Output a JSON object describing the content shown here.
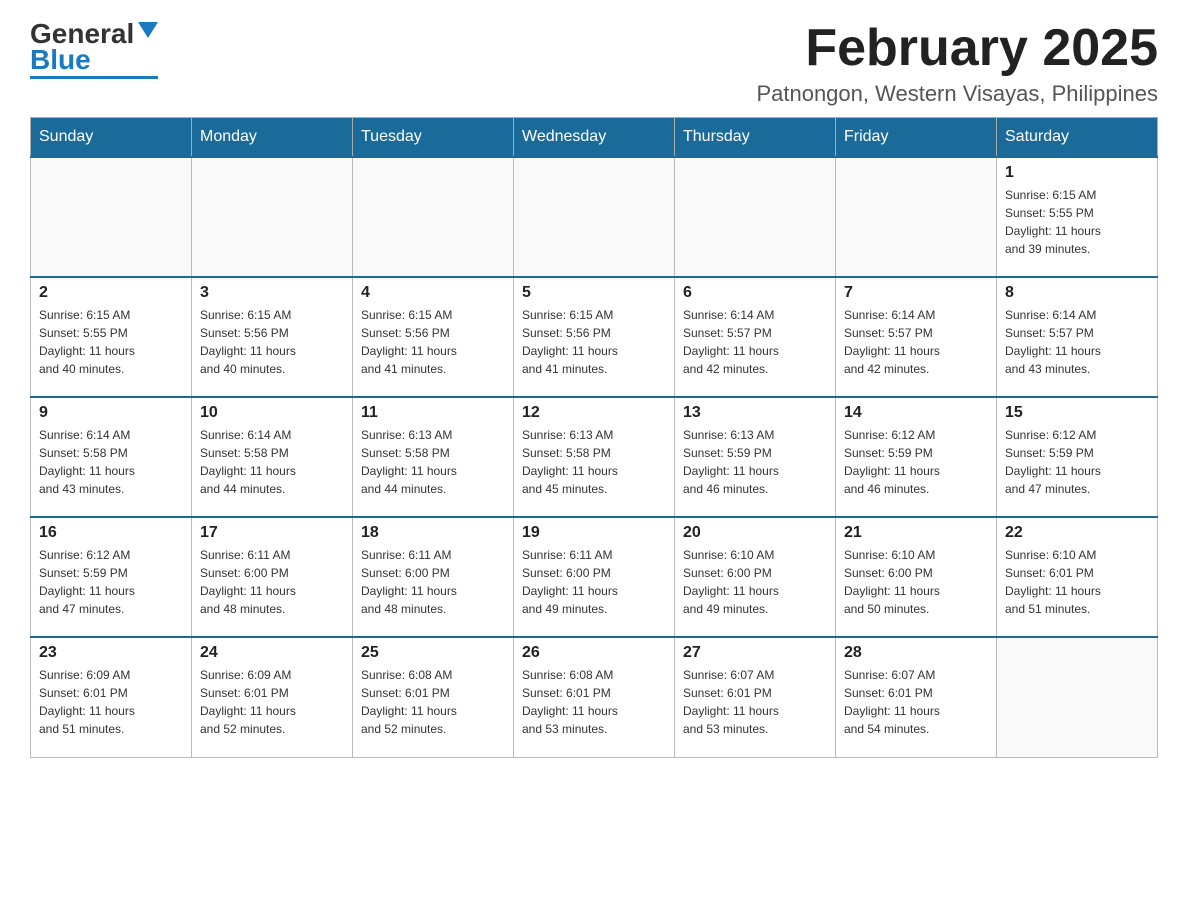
{
  "header": {
    "logo": {
      "general": "General",
      "blue": "Blue"
    },
    "title": "February 2025",
    "location": "Patnongon, Western Visayas, Philippines"
  },
  "calendar": {
    "days_of_week": [
      "Sunday",
      "Monday",
      "Tuesday",
      "Wednesday",
      "Thursday",
      "Friday",
      "Saturday"
    ],
    "weeks": [
      [
        {
          "day": "",
          "info": ""
        },
        {
          "day": "",
          "info": ""
        },
        {
          "day": "",
          "info": ""
        },
        {
          "day": "",
          "info": ""
        },
        {
          "day": "",
          "info": ""
        },
        {
          "day": "",
          "info": ""
        },
        {
          "day": "1",
          "info": "Sunrise: 6:15 AM\nSunset: 5:55 PM\nDaylight: 11 hours\nand 39 minutes."
        }
      ],
      [
        {
          "day": "2",
          "info": "Sunrise: 6:15 AM\nSunset: 5:55 PM\nDaylight: 11 hours\nand 40 minutes."
        },
        {
          "day": "3",
          "info": "Sunrise: 6:15 AM\nSunset: 5:56 PM\nDaylight: 11 hours\nand 40 minutes."
        },
        {
          "day": "4",
          "info": "Sunrise: 6:15 AM\nSunset: 5:56 PM\nDaylight: 11 hours\nand 41 minutes."
        },
        {
          "day": "5",
          "info": "Sunrise: 6:15 AM\nSunset: 5:56 PM\nDaylight: 11 hours\nand 41 minutes."
        },
        {
          "day": "6",
          "info": "Sunrise: 6:14 AM\nSunset: 5:57 PM\nDaylight: 11 hours\nand 42 minutes."
        },
        {
          "day": "7",
          "info": "Sunrise: 6:14 AM\nSunset: 5:57 PM\nDaylight: 11 hours\nand 42 minutes."
        },
        {
          "day": "8",
          "info": "Sunrise: 6:14 AM\nSunset: 5:57 PM\nDaylight: 11 hours\nand 43 minutes."
        }
      ],
      [
        {
          "day": "9",
          "info": "Sunrise: 6:14 AM\nSunset: 5:58 PM\nDaylight: 11 hours\nand 43 minutes."
        },
        {
          "day": "10",
          "info": "Sunrise: 6:14 AM\nSunset: 5:58 PM\nDaylight: 11 hours\nand 44 minutes."
        },
        {
          "day": "11",
          "info": "Sunrise: 6:13 AM\nSunset: 5:58 PM\nDaylight: 11 hours\nand 44 minutes."
        },
        {
          "day": "12",
          "info": "Sunrise: 6:13 AM\nSunset: 5:58 PM\nDaylight: 11 hours\nand 45 minutes."
        },
        {
          "day": "13",
          "info": "Sunrise: 6:13 AM\nSunset: 5:59 PM\nDaylight: 11 hours\nand 46 minutes."
        },
        {
          "day": "14",
          "info": "Sunrise: 6:12 AM\nSunset: 5:59 PM\nDaylight: 11 hours\nand 46 minutes."
        },
        {
          "day": "15",
          "info": "Sunrise: 6:12 AM\nSunset: 5:59 PM\nDaylight: 11 hours\nand 47 minutes."
        }
      ],
      [
        {
          "day": "16",
          "info": "Sunrise: 6:12 AM\nSunset: 5:59 PM\nDaylight: 11 hours\nand 47 minutes."
        },
        {
          "day": "17",
          "info": "Sunrise: 6:11 AM\nSunset: 6:00 PM\nDaylight: 11 hours\nand 48 minutes."
        },
        {
          "day": "18",
          "info": "Sunrise: 6:11 AM\nSunset: 6:00 PM\nDaylight: 11 hours\nand 48 minutes."
        },
        {
          "day": "19",
          "info": "Sunrise: 6:11 AM\nSunset: 6:00 PM\nDaylight: 11 hours\nand 49 minutes."
        },
        {
          "day": "20",
          "info": "Sunrise: 6:10 AM\nSunset: 6:00 PM\nDaylight: 11 hours\nand 49 minutes."
        },
        {
          "day": "21",
          "info": "Sunrise: 6:10 AM\nSunset: 6:00 PM\nDaylight: 11 hours\nand 50 minutes."
        },
        {
          "day": "22",
          "info": "Sunrise: 6:10 AM\nSunset: 6:01 PM\nDaylight: 11 hours\nand 51 minutes."
        }
      ],
      [
        {
          "day": "23",
          "info": "Sunrise: 6:09 AM\nSunset: 6:01 PM\nDaylight: 11 hours\nand 51 minutes."
        },
        {
          "day": "24",
          "info": "Sunrise: 6:09 AM\nSunset: 6:01 PM\nDaylight: 11 hours\nand 52 minutes."
        },
        {
          "day": "25",
          "info": "Sunrise: 6:08 AM\nSunset: 6:01 PM\nDaylight: 11 hours\nand 52 minutes."
        },
        {
          "day": "26",
          "info": "Sunrise: 6:08 AM\nSunset: 6:01 PM\nDaylight: 11 hours\nand 53 minutes."
        },
        {
          "day": "27",
          "info": "Sunrise: 6:07 AM\nSunset: 6:01 PM\nDaylight: 11 hours\nand 53 minutes."
        },
        {
          "day": "28",
          "info": "Sunrise: 6:07 AM\nSunset: 6:01 PM\nDaylight: 11 hours\nand 54 minutes."
        },
        {
          "day": "",
          "info": ""
        }
      ]
    ]
  }
}
